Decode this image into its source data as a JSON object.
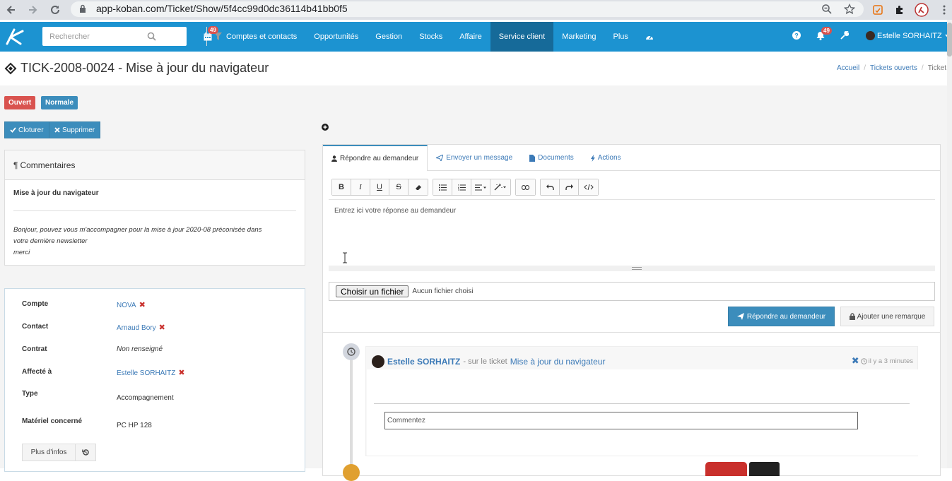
{
  "browser": {
    "url": "app-koban.com/Ticket/Show/5f4cc99d0dc36114b41bb0f5"
  },
  "topbar": {
    "search_placeholder": "Rechercher",
    "calendar_badge": "49",
    "notif_badge": "49",
    "menu": [
      {
        "label": "Comptes et contacts"
      },
      {
        "label": "Opportunités"
      },
      {
        "label": "Gestion"
      },
      {
        "label": "Stocks"
      },
      {
        "label": "Affaire"
      },
      {
        "label": "Service client"
      },
      {
        "label": "Marketing"
      },
      {
        "label": "Plus"
      }
    ],
    "active_menu": "Service client",
    "user_name": "Estelle SORHAITZ"
  },
  "page": {
    "title": "TICK-2008-0024 - Mise à jour du navigateur",
    "breadcrumb": [
      "Accueil",
      "Tickets ouverts",
      "Ticket"
    ]
  },
  "labels": {
    "status": "Ouvert",
    "priority": "Normale",
    "status_color": "#d9534f",
    "priority_color": "#3c8dbc"
  },
  "actions": {
    "close": "Cloturer",
    "delete": "Supprimer"
  },
  "comments": {
    "header": "Commentaires",
    "title": "Mise à jour du navigateur",
    "lines": [
      "Bonjour, pouvez vous m'accompagner pour la mise à jour 2020-08 préconisée dans",
      "votre dernière newsletter",
      "merci"
    ]
  },
  "info": {
    "rows": [
      {
        "key": "Compte",
        "value": "NOVA"
      },
      {
        "key": "Contact",
        "value": "Arnaud Bory"
      },
      {
        "key": "Contrat",
        "value": "Non renseigné"
      },
      {
        "key": "Affecté à",
        "value": "Estelle SORHAITZ"
      },
      {
        "key": "Type",
        "value": "Accompagnement"
      },
      {
        "key": "Matériel concerné",
        "value": "PC HP 128"
      }
    ],
    "more_button": "Plus d'infos"
  },
  "tabs": [
    {
      "label": "Répondre au demandeur"
    },
    {
      "label": "Envoyer un message"
    },
    {
      "label": "Documents"
    },
    {
      "label": "Actions"
    }
  ],
  "editor": {
    "placeholder": "Entrez ici votre réponse au demandeur",
    "toolbar": [
      "B",
      "I",
      "U",
      "S"
    ]
  },
  "file": {
    "button": "Choisir un fichier",
    "status": "Aucun fichier choisi"
  },
  "reply": {
    "submit": "Répondre au demandeur",
    "remark": "Ajouter une remarque"
  },
  "timeline": {
    "author": "Estelle SORHAITZ",
    "middle": "- sur le ticket",
    "ticket": "Mise à jour du navigateur",
    "time": "il y a 3 minutes",
    "comment_placeholder": "Commentez"
  }
}
